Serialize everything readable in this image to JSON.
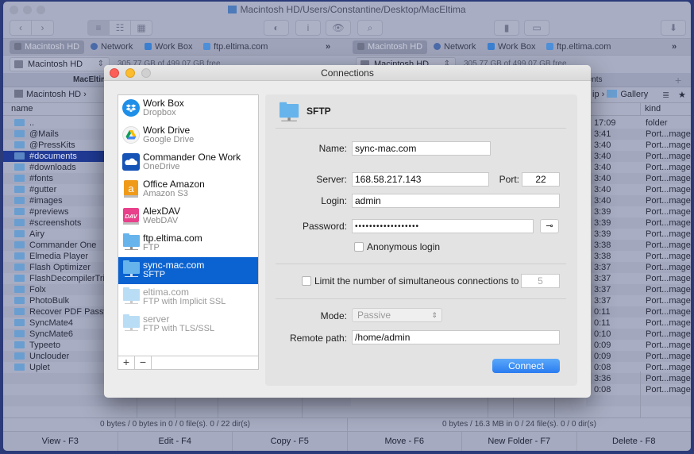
{
  "window": {
    "title": "Macintosh HD/Users/Constantine/Desktop/MacEltima"
  },
  "toolbar": {
    "back_label": "‹",
    "forward_label": "›",
    "view_list": "≡",
    "view_detail": "☷",
    "view_grid": "▦",
    "toggle_hidden": "◐",
    "info": "i",
    "preview": "👁",
    "find": "⌕",
    "archive": "▮",
    "network": "▭",
    "download": "⬇"
  },
  "favorites": {
    "left": [
      "Macintosh HD",
      "Network",
      "Work Box",
      "ftp.eltima.com"
    ],
    "right": [
      "Macintosh HD",
      "Network",
      "Work Box",
      "ftp.eltima.com"
    ],
    "more": "»"
  },
  "drive": {
    "left_name": "Macintosh HD",
    "left_free": "305.77 GB of 499.07 GB free",
    "right_name": "Macintosh HD",
    "right_free": "305.77 GB of 499.07 GB free"
  },
  "left_pane": {
    "tab": "MacEltima",
    "path_root": "Macintosh HD",
    "path_sep": "›",
    "column_name": "name",
    "files": [
      "..",
      "@Mails",
      "@PressKits",
      "#documents",
      "#downloads",
      "#fonts",
      "#gutter",
      "#images",
      "#previews",
      "#screenshots",
      "Airy",
      "Commander One",
      "Elmedia Player",
      "Flash Optimizer",
      "FlashDecompilerTrillix",
      "Folx",
      "PhotoBulk",
      "Recover PDF Password",
      "SyncMate4",
      "SyncMate6",
      "Typeeto",
      "Unclouder",
      "Uplet"
    ],
    "selected_index": 3,
    "status": "0 bytes / 0 bytes in 0 / 0 file(s). 0 / 22 dir(s)"
  },
  "right_pane": {
    "tab": "#documents",
    "tab_add": "+",
    "path_partial": "ip",
    "path_sep": "›",
    "path_folder": "Gallery",
    "column_kind": "kind",
    "times": [
      "17:09",
      "3:41",
      "3:40",
      "3:40",
      "3:40",
      "3:40",
      "3:40",
      "3:40",
      "3:39",
      "3:39",
      "3:39",
      "3:38",
      "3:38",
      "3:37",
      "3:37",
      "3:37",
      "3:37",
      "0:11",
      "0:11",
      "0:10",
      "0:09",
      "0:09",
      "0:08",
      "3:36",
      "0:08"
    ],
    "kinds": [
      "folder",
      "Port...mage",
      "Port...mage",
      "Port...mage",
      "Port...mage",
      "Port...mage",
      "Port...mage",
      "Port...mage",
      "Port...mage",
      "Port...mage",
      "Port...mage",
      "Port...mage",
      "Port...mage",
      "Port...mage",
      "Port...mage",
      "Port...mage",
      "Port...mage",
      "Port...mage",
      "Port...mage",
      "Port...mage",
      "Port...mage",
      "Port...mage",
      "Port...mage",
      "Port...mage",
      "Port...mage"
    ],
    "status": "0 bytes / 16.3 MB in 0 / 24 file(s). 0 / 0 dir(s)"
  },
  "function_keys": [
    "View - F3",
    "Edit - F4",
    "Copy - F5",
    "Move - F6",
    "New Folder - F7",
    "Delete - F8"
  ],
  "dialog": {
    "title": "Connections",
    "connections": [
      {
        "name": "Work Box",
        "type": "Dropbox",
        "icon": "dropbox-icon",
        "color": "#1e8fe8",
        "state": "normal"
      },
      {
        "name": "Work Drive",
        "type": "Google Drive",
        "icon": "google-drive-icon",
        "color": "#f2f2f2",
        "state": "normal"
      },
      {
        "name": "Commander One Work",
        "type": "OneDrive",
        "icon": "onedrive-icon",
        "color": "#1553b6",
        "state": "normal"
      },
      {
        "name": "Office Amazon",
        "type": "Amazon S3",
        "icon": "amazon-s3-icon",
        "color": "#f09a1a",
        "state": "normal"
      },
      {
        "name": "AlexDAV",
        "type": "WebDAV",
        "icon": "webdav-icon",
        "color": "#e8408a",
        "state": "normal"
      },
      {
        "name": "ftp.eltima.com",
        "type": "FTP",
        "icon": "server-folder-icon",
        "state": "normal"
      },
      {
        "name": "sync-mac.com",
        "type": "SFTP",
        "icon": "server-folder-icon",
        "state": "selected"
      },
      {
        "name": "eltima.com",
        "type": "FTP with Implicit SSL",
        "icon": "server-folder-icon",
        "state": "dim"
      },
      {
        "name": "server",
        "type": "FTP with TLS/SSL",
        "icon": "server-folder-icon",
        "state": "dim"
      }
    ],
    "add_label": "+",
    "remove_label": "−",
    "form": {
      "protocol": "SFTP",
      "name_label": "Name:",
      "name_value": "sync-mac.com",
      "server_label": "Server:",
      "server_value": "168.58.217.143",
      "port_label": "Port:",
      "port_value": "22",
      "login_label": "Login:",
      "login_value": "admin",
      "password_label": "Password:",
      "password_value": "••••••••••••••••••",
      "key_button": "⊸",
      "anonymous_label": "Anonymous login",
      "anonymous_checked": false,
      "limit_label": "Limit the number of simultaneous connections to",
      "limit_checked": false,
      "limit_value": "5",
      "mode_label": "Mode:",
      "mode_value": "Passive",
      "remote_path_label": "Remote path:",
      "remote_path_value": "/home/admin",
      "connect_label": "Connect"
    }
  }
}
